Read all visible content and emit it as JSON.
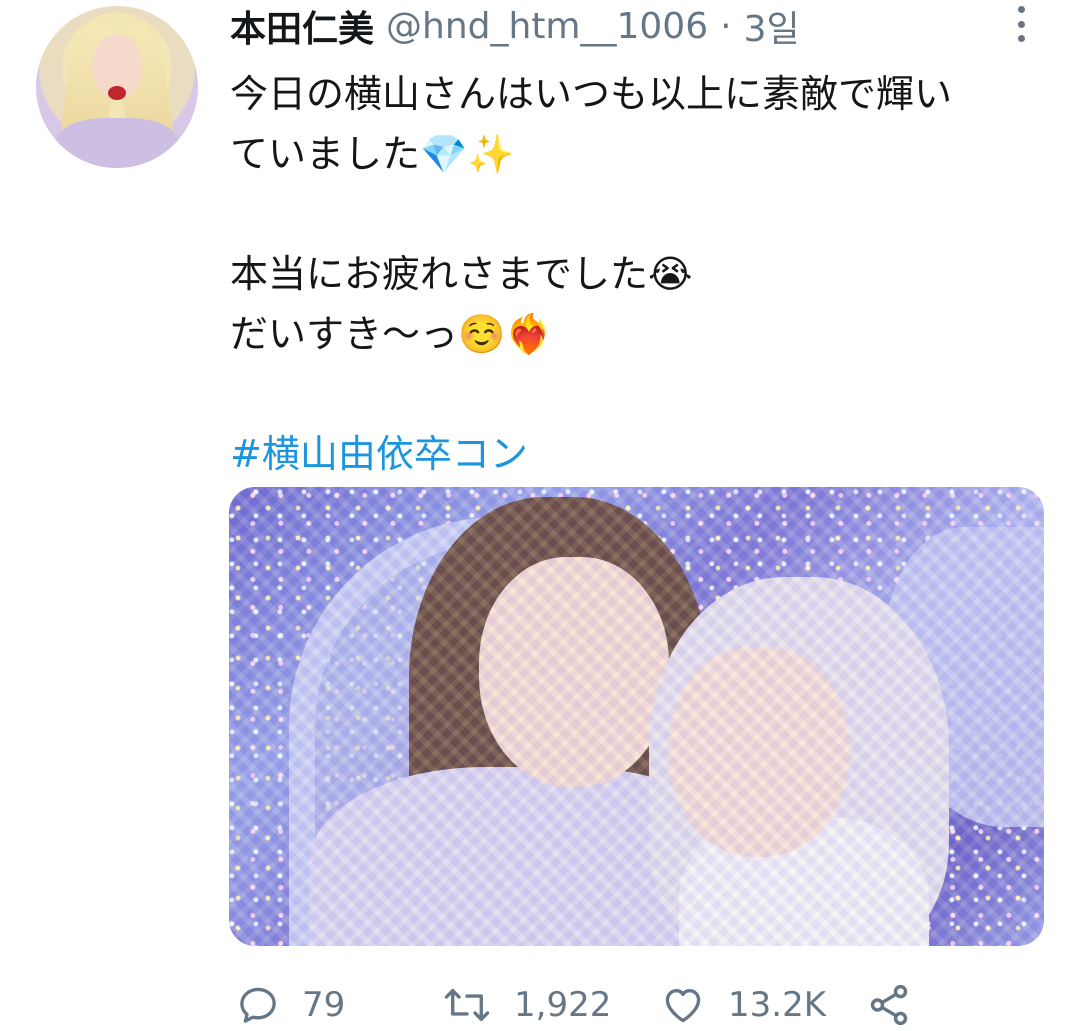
{
  "author": {
    "display_name": "本田仁美",
    "handle": "@hnd_htm__1006",
    "separator": "·",
    "time": "3일"
  },
  "tweet": {
    "lines": [
      "今日の横山さんはいつも以上に素敵で輝い",
      "ていました💎✨",
      "",
      "本当にお疲れさまでした😭",
      "だいすき〜っ☺️❤️‍🔥",
      ""
    ],
    "hashtag": "#横山由依卒コン"
  },
  "actions": {
    "replies": "79",
    "retweets": "1,922",
    "likes": "13.2K"
  },
  "icons": {
    "reply": "reply-icon",
    "retweet": "retweet-icon",
    "like": "heart-icon",
    "share": "share-icon",
    "more": "more-vertical-icon"
  },
  "colors": {
    "text": "#14171a",
    "muted": "#657786",
    "hashtag": "#1b95e0"
  }
}
